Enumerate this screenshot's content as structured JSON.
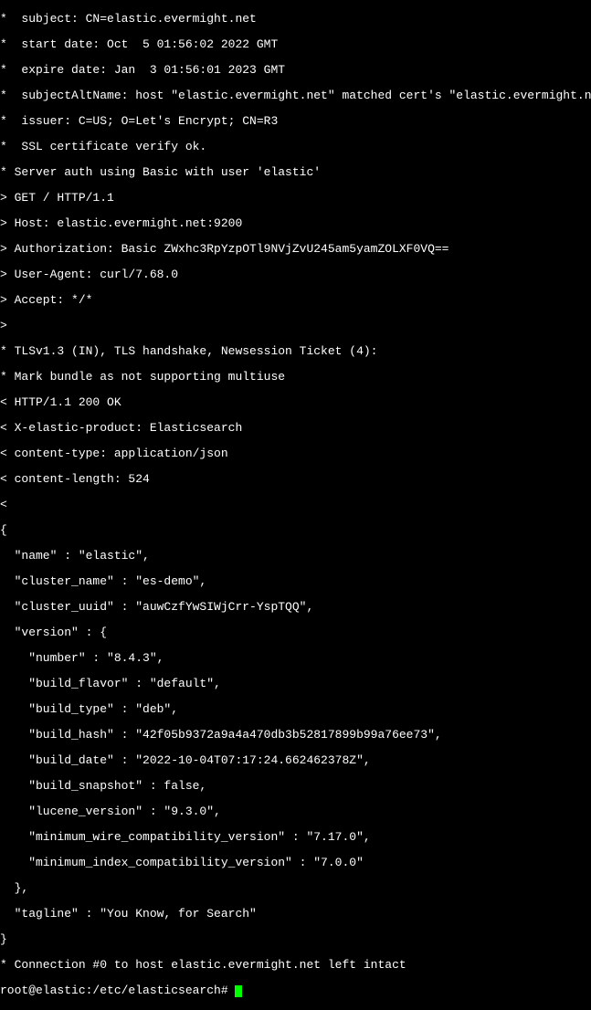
{
  "lines": {
    "l0": "*  subject: CN=elastic.evermight.net",
    "l1": "*  start date: Oct  5 01:56:02 2022 GMT",
    "l2": "*  expire date: Jan  3 01:56:01 2023 GMT",
    "l3": "*  subjectAltName: host \"elastic.evermight.net\" matched cert's \"elastic.evermight.net\"",
    "l4": "*  issuer: C=US; O=Let's Encrypt; CN=R3",
    "l5": "*  SSL certificate verify ok.",
    "l6": "* Server auth using Basic with user 'elastic'",
    "l7": "> GET / HTTP/1.1",
    "l8": "> Host: elastic.evermight.net:9200",
    "l9": "> Authorization: Basic ZWxhc3RpYzpOTl9NVjZvU245am5yamZOLXF0VQ==",
    "l10": "> User-Agent: curl/7.68.0",
    "l11": "> Accept: */*",
    "l12": ">",
    "l13": "* TLSv1.3 (IN), TLS handshake, Newsession Ticket (4):",
    "l14": "* Mark bundle as not supporting multiuse",
    "l15": "< HTTP/1.1 200 OK",
    "l16": "< X-elastic-product: Elasticsearch",
    "l17": "< content-type: application/json",
    "l18": "< content-length: 524",
    "l19": "<",
    "l20": "{",
    "l21": "  \"name\" : \"elastic\",",
    "l22": "  \"cluster_name\" : \"es-demo\",",
    "l23": "  \"cluster_uuid\" : \"auwCzfYwSIWjCrr-YspTQQ\",",
    "l24": "  \"version\" : {",
    "l25": "    \"number\" : \"8.4.3\",",
    "l26": "    \"build_flavor\" : \"default\",",
    "l27": "    \"build_type\" : \"deb\",",
    "l28": "    \"build_hash\" : \"42f05b9372a9a4a470db3b52817899b99a76ee73\",",
    "l29": "    \"build_date\" : \"2022-10-04T07:17:24.662462378Z\",",
    "l30": "    \"build_snapshot\" : false,",
    "l31": "    \"lucene_version\" : \"9.3.0\",",
    "l32": "    \"minimum_wire_compatibility_version\" : \"7.17.0\",",
    "l33": "    \"minimum_index_compatibility_version\" : \"7.0.0\"",
    "l34": "  },",
    "l35": "  \"tagline\" : \"You Know, for Search\"",
    "l36": "}",
    "l37": "* Connection #0 to host elastic.evermight.net left intact",
    "prompt": "root@elastic:/etc/elasticsearch# "
  }
}
